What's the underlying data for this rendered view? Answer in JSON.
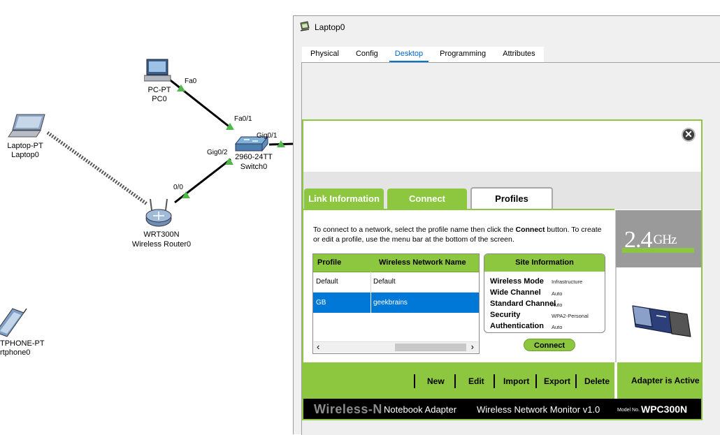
{
  "topology": {
    "devices": [
      {
        "type": "PC-PT",
        "name": "PC0"
      },
      {
        "type": "Laptop-PT",
        "name": "Laptop0"
      },
      {
        "type": "2960-24TT",
        "name": "Switch0"
      },
      {
        "type": "WRT300N",
        "name": "Wireless Router0"
      },
      {
        "type": "TPHONE-PT",
        "name": "rtphone0"
      }
    ],
    "ports": [
      "Fa0",
      "Fa0/1",
      "Gig0/1",
      "Gig0/2",
      "0/0"
    ]
  },
  "window": {
    "title": "Laptop0",
    "tabs": [
      "Physical",
      "Config",
      "Desktop",
      "Programming",
      "Attributes"
    ],
    "active_tab": "Desktop"
  },
  "monitor": {
    "close_glyph": "✕",
    "tabs": [
      "Link Information",
      "Connect",
      "Profiles"
    ],
    "active_tab": "Profiles",
    "instructions": {
      "part1": "To connect to a network, select the profile name then click the ",
      "bold": "Connect",
      "part2": " button. To create or edit a profile, use the menu bar at the bottom of the screen."
    },
    "profile_table": {
      "headers": [
        "Profile",
        "Wireless Network Name"
      ],
      "rows": [
        {
          "profile": "Default",
          "network": "Default"
        },
        {
          "profile": "GB",
          "network": "geekbrains"
        }
      ],
      "selected_row": 1,
      "scroll_left": "‹",
      "scroll_right": "›"
    },
    "site_info": {
      "title": "Site Information",
      "rows": [
        {
          "label": "Wireless Mode",
          "value": "Infrastructure"
        },
        {
          "label": "Wide Channel",
          "value": "Auto"
        },
        {
          "label": "Standard Channel",
          "value": "Auto"
        },
        {
          "label": "Security",
          "value": "WPA2-Personal"
        },
        {
          "label": "Authentication",
          "value": "Auto"
        }
      ]
    },
    "connect_button": "Connect",
    "band": {
      "number": "2.4",
      "unit": "GHz"
    },
    "actions": [
      "New",
      "Edit",
      "Import",
      "Export",
      "Delete"
    ],
    "adapter_status": "Adapter is Active",
    "footer": {
      "brand": "Wireless-N",
      "product": "Notebook Adapter",
      "monitor": "Wireless Network Monitor  v1.0",
      "model_label": "Model No.",
      "model": "WPC300N"
    }
  },
  "colors": {
    "accent_green": "#8dc63f",
    "selection_blue": "#0078d7",
    "link_black": "#000000",
    "port_green": "#4fb848"
  }
}
